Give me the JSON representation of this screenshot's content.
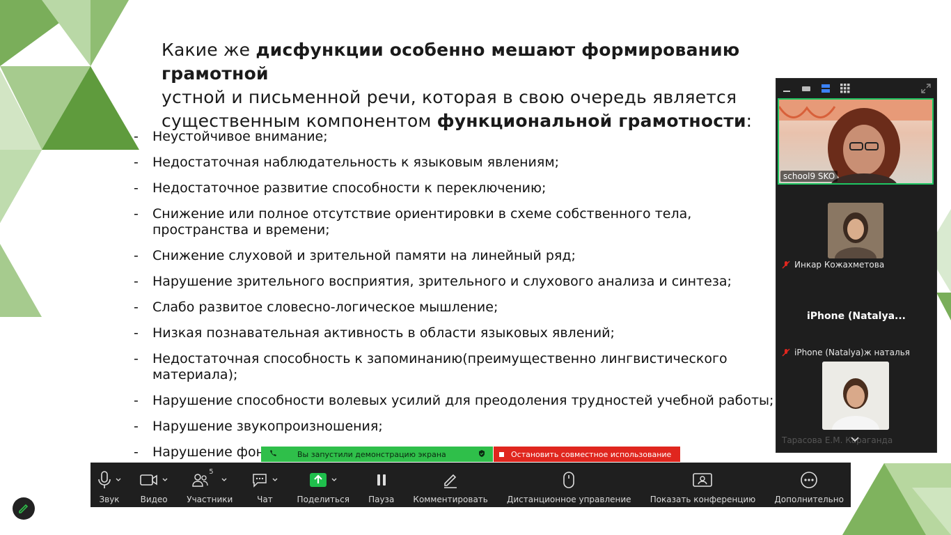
{
  "slide": {
    "heading": {
      "p1": "Какие же ",
      "b1": "дисфункции особенно мешают формированию грамотной",
      "p2": "устной и письменной речи, которая в свою очередь является",
      "p3": "существенным компонентом ",
      "b2": "функциональной грамотности",
      "p4": ":"
    },
    "bullets": [
      "Неустойчивое внимание;",
      "Недостаточная наблюдательность к языковым явлениям;",
      "Недостаточное развитие способности к переключению;",
      "Снижение или полное отсутствие ориентировки в схеме собственного тела, пространства и времени;",
      "Снижение слуховой и зрительной памяти на линейный ряд;",
      "Нарушение зрительного восприятия, зрительного и слухового анализа и синтеза;",
      "Слабо развитое словесно-логическое мышление;",
      "Низкая познавательная активность в области языковых явлений;",
      "Недостаточная способность к запоминанию(преимущественно лингвистического материала);",
      "Нарушение способности волевых усилий для преодоления трудностей учебной работы;",
      "Нарушение звукопроизношения;",
      "Нарушение фон"
    ]
  },
  "panel": {
    "main_name": "school9 SKO",
    "p2_name": "Инкар Кожахметова",
    "p3_big": "iPhone  (Natalya...",
    "p3_name": "iPhone (Natalya)ж   наталья",
    "p4_name": "Тарасова Е.М. Караганда"
  },
  "banner": {
    "green": "Вы запустили демонстрацию экрана",
    "red": "Остановить совместное использование"
  },
  "toolbar": {
    "audio": "Звук",
    "video": "Видео",
    "participants": "Участники",
    "participants_count": "5",
    "chat": "Чат",
    "share": "Поделиться",
    "pause": "Пауза",
    "annotate": "Комментировать",
    "remote": "Дистанционное управление",
    "show_meeting": "Показать конференцию",
    "more": "Дополнительно"
  },
  "colors": {
    "green_dark": "#5a9a3a",
    "green_light": "#a9cc91",
    "banner_green": "#2fbf4a",
    "banner_red": "#e0261e",
    "toolbar_bg": "#1f1f1f",
    "share_green": "#1fbf4c"
  }
}
